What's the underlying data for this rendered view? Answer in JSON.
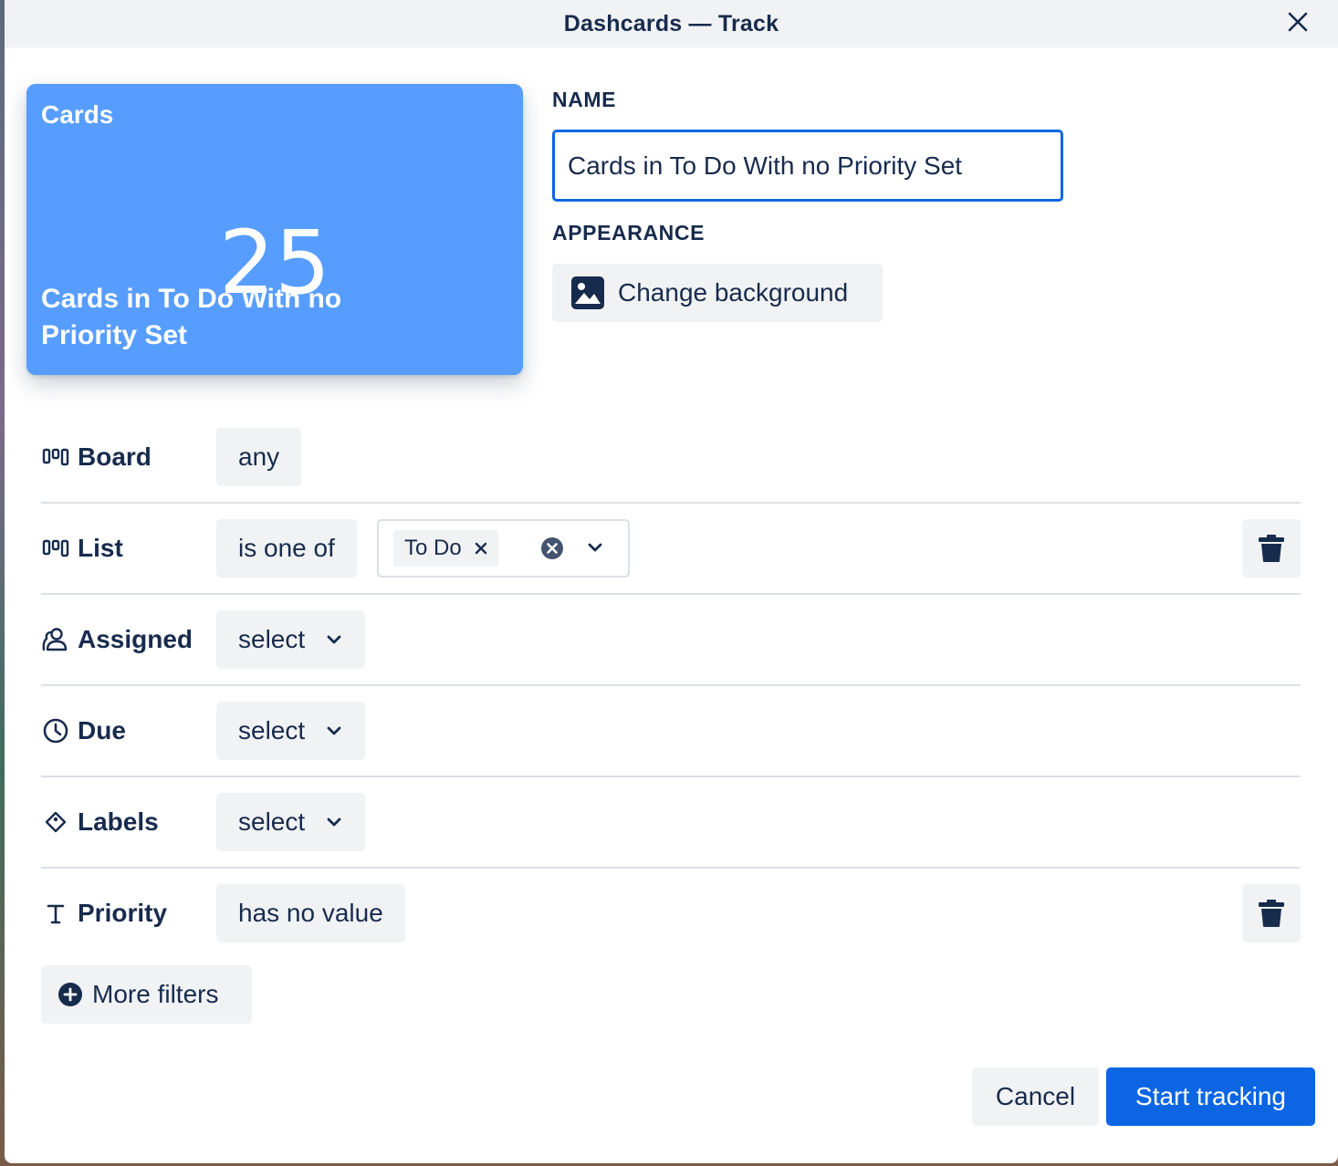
{
  "dialog": {
    "title": "Dashcards — Track"
  },
  "preview": {
    "type_label": "Cards",
    "count": "25",
    "name": "Cards in To Do With no Priority Set",
    "bg_color": "#579dff"
  },
  "name_section": {
    "label": "NAME",
    "value": "Cards in To Do With no Priority Set"
  },
  "appearance": {
    "label": "APPEARANCE",
    "button_label": "Change background",
    "icon": "image-icon"
  },
  "filters": {
    "board": {
      "label": "Board",
      "icon": "board-icon",
      "value": "any"
    },
    "list": {
      "label": "List",
      "icon": "list-icon",
      "operator": "is one of",
      "selected": [
        "To Do"
      ]
    },
    "assigned": {
      "label": "Assigned",
      "icon": "users-icon",
      "value": "select"
    },
    "due": {
      "label": "Due",
      "icon": "clock-icon",
      "value": "select"
    },
    "labels": {
      "label": "Labels",
      "icon": "tag-icon",
      "value": "select"
    },
    "priority": {
      "label": "Priority",
      "icon": "text-field-icon",
      "value": "has no value"
    }
  },
  "more_filters": {
    "label": "More filters",
    "icon": "plus-circle-icon"
  },
  "actions": {
    "cancel": "Cancel",
    "start": "Start tracking"
  },
  "colors": {
    "primary": "#0c66e4",
    "neutral_button": "#f1f2f4",
    "text": "#172b4d",
    "divider": "#dcdfe4"
  }
}
